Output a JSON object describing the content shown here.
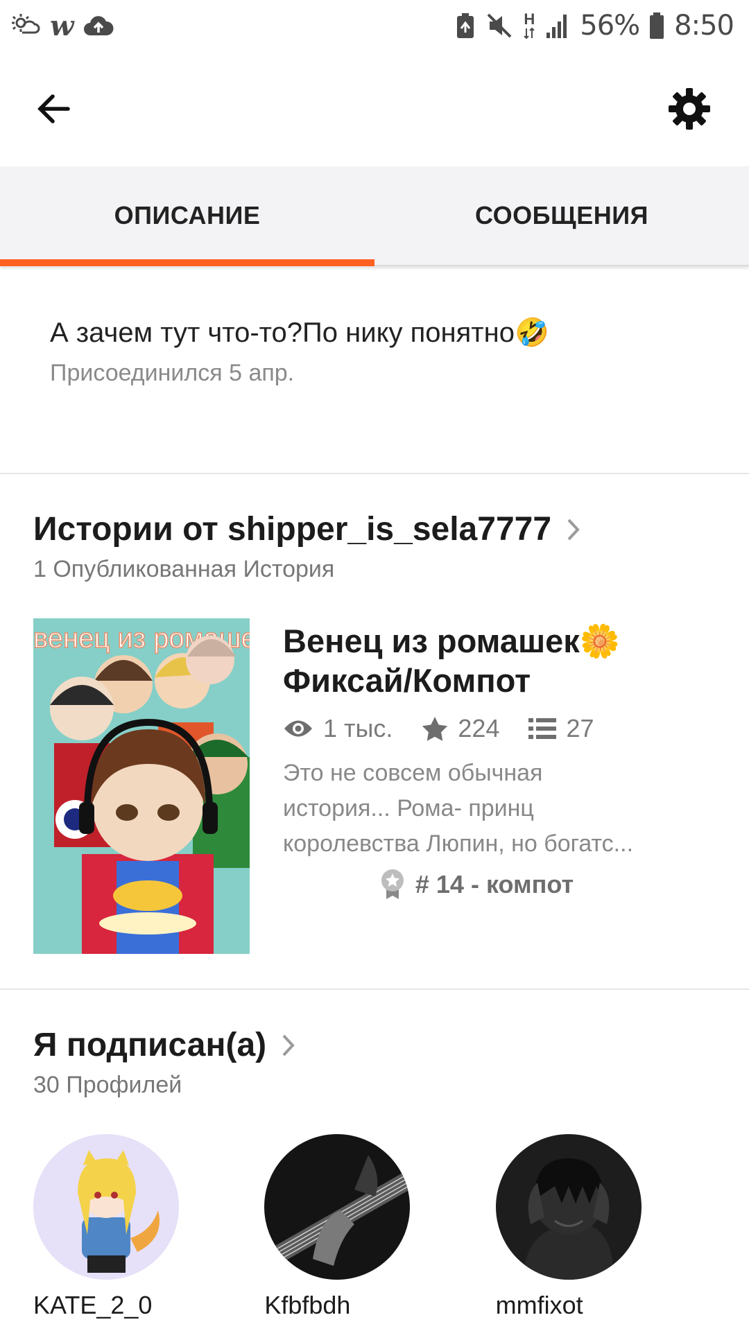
{
  "status_bar": {
    "left_icons": [
      "weather-icon",
      "wattpad-w-icon",
      "cloud-upload-icon"
    ],
    "wattpad_letter": "w",
    "network_label": "H",
    "battery_percent": "56%",
    "time": "8:50"
  },
  "tabs": [
    {
      "label": "ОПИСАНИЕ",
      "active": true
    },
    {
      "label": "СООБЩЕНИЯ",
      "active": false
    }
  ],
  "about": {
    "text": "А зачем тут что-то?По нику понятно🤣",
    "joined": "Присоединился 5 апр."
  },
  "stories_section": {
    "title": "Истории от shipper_is_sela7777",
    "subtitle": "1 Опубликованная История"
  },
  "story": {
    "cover_text": "венец из ромашек",
    "title_line1": "Венец из ромашек🌼",
    "title_line2": "Фиксай/Компот",
    "views": "1 тыс.",
    "votes": "224",
    "parts": "27",
    "description_lines": [
      "Это не совсем обычная",
      "история... Рома- принц",
      "королевства Люпин, но богатс..."
    ],
    "rank": "# 14 - компот"
  },
  "following_section": {
    "title": "Я подписан(а)",
    "subtitle": "30 Профилей"
  },
  "profiles": [
    {
      "name": "KATE_2_0"
    },
    {
      "name": "Kfbfbdh"
    },
    {
      "name": "mmfixot"
    }
  ],
  "colors": {
    "accent": "#ff6122",
    "tab_bg": "#f3f3f5"
  }
}
